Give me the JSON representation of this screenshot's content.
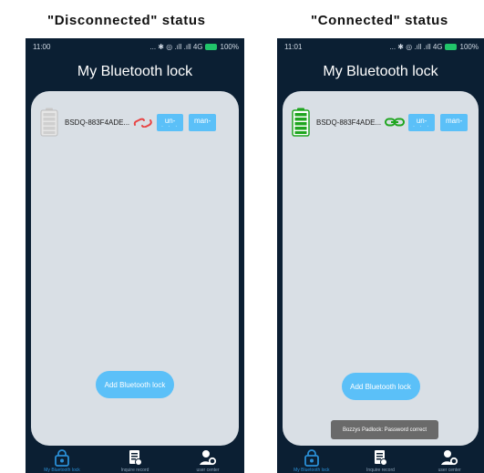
{
  "captions": {
    "left": "\"Disconnected\" status",
    "right": "\"Connected\" status"
  },
  "screens": [
    {
      "status_time": "11:00",
      "status_right": "... ✱ ◎ .ıll .ıll 4G",
      "battery_pct": "100%",
      "app_title": "My Bluetooth lock",
      "device": {
        "name": "BSDQ-883F4ADE...",
        "state": "disconnected",
        "battery_icon": "battery-empty-gray",
        "link_icon": "broken-link-icon",
        "unlock_label": "un-",
        "unlock_sub": "· · ·",
        "manage_label": "man-"
      },
      "add_button": "Add Bluetooth lock",
      "nav": [
        "My Bluetooth lock",
        "Inquire record",
        "user center"
      ]
    },
    {
      "status_time": "11:01",
      "status_right": "... ✱ ◎ .ıll .ıll 4G",
      "battery_pct": "100%",
      "app_title": "My Bluetooth lock",
      "device": {
        "name": "BSDQ-883F4ADE...",
        "state": "connected",
        "battery_icon": "battery-full-green",
        "link_icon": "chain-link-icon",
        "unlock_label": "un-",
        "unlock_sub": "· · ·",
        "manage_label": "man-"
      },
      "add_button": "Add Bluetooth lock",
      "toast": "Bozzys Padlock: Password correct",
      "nav": [
        "My Bluetooth lock",
        "Inquire record",
        "user center"
      ]
    }
  ],
  "colors": {
    "screen_bg": "#0b1f33",
    "card_bg": "#d9dfe5",
    "accent": "#5bc0f8",
    "connected": "#1fa51f",
    "disconnected": "#e84545",
    "nav_active": "#2a8fd6"
  }
}
